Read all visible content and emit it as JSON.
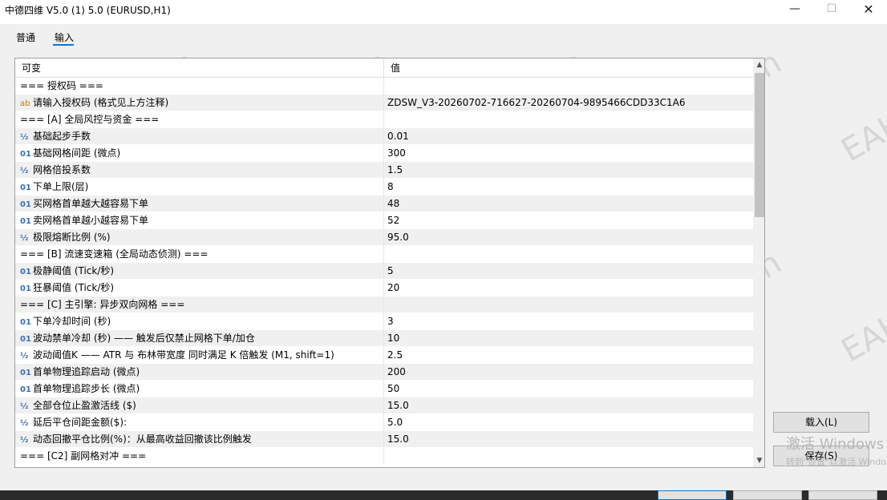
{
  "window": {
    "title": "中德四维 V5.0 (1) 5.0 (EURUSD,H1)",
    "minimize_glyph": "—",
    "maximize_glyph": "☐",
    "close_glyph": "✕"
  },
  "tabs": [
    {
      "label": "普通",
      "active": false
    },
    {
      "label": "输入",
      "active": true
    }
  ],
  "table": {
    "headers": {
      "variable": "可变",
      "value": "值"
    },
    "rows": [
      {
        "icon": "",
        "label": "=== 授权码 ===",
        "value": ""
      },
      {
        "icon": "ab",
        "label": "请输入授权码 (格式见上方注释)",
        "value": "ZDSW_V3-20260702-716627-20260704-9895466CDD33C1A6"
      },
      {
        "icon": "",
        "label": "=== [A] 全局风控与资金 ===",
        "value": ""
      },
      {
        "icon": "½",
        "label": "基础起步手数",
        "value": "0.01"
      },
      {
        "icon": "01",
        "label": "基础网格间距 (微点)",
        "value": "300"
      },
      {
        "icon": "½",
        "label": "网格倍投系数",
        "value": "1.5"
      },
      {
        "icon": "01",
        "label": "下单上限(层)",
        "value": "8"
      },
      {
        "icon": "01",
        "label": "买网格首单越大越容易下单",
        "value": "48"
      },
      {
        "icon": "01",
        "label": "卖网格首单越小越容易下单",
        "value": "52"
      },
      {
        "icon": "½",
        "label": "极限熔断比例 (%)",
        "value": "95.0"
      },
      {
        "icon": "",
        "label": "=== [B] 流速变速箱 (全局动态侦测) ===",
        "value": ""
      },
      {
        "icon": "01",
        "label": "极静阈值 (Tick/秒)",
        "value": "5"
      },
      {
        "icon": "01",
        "label": "狂暴阈值 (Tick/秒)",
        "value": "20"
      },
      {
        "icon": "",
        "label": "=== [C] 主引擎: 异步双向网格 ===",
        "value": ""
      },
      {
        "icon": "01",
        "label": "下单冷却时间 (秒)",
        "value": "3"
      },
      {
        "icon": "01",
        "label": "波动禁单冷却 (秒) —— 触发后仅禁止网格下单/加仓",
        "value": "10"
      },
      {
        "icon": "½",
        "label": "波动阈值K —— ATR 与 布林带宽度 同时满足 K 倍触发 (M1, shift=1)",
        "value": "2.5"
      },
      {
        "icon": "01",
        "label": "首单物理追踪启动 (微点)",
        "value": "200"
      },
      {
        "icon": "01",
        "label": "首单物理追踪步长 (微点)",
        "value": "50"
      },
      {
        "icon": "½",
        "label": "全部仓位止盈激活线 ($)",
        "value": "15.0"
      },
      {
        "icon": "½",
        "label": "延后平仓间距金额($):",
        "value": "5.0"
      },
      {
        "icon": "½",
        "label": "动态回撤平仓比例(%)：从最高收益回撤该比例触发",
        "value": "15.0"
      },
      {
        "icon": "",
        "label": "=== [C2] 副网格对冲 ===",
        "value": ""
      }
    ]
  },
  "scrollbar": {
    "up_glyph": "▲",
    "down_glyph": "▼"
  },
  "buttons": {
    "load": "载入(L)",
    "save": "保存(S)"
  },
  "watermark": {
    "text": "EAHub.cn"
  },
  "activation_notice": {
    "title": "激活 Windows",
    "subtitle": "转到\"设置\"以激活 Windows。"
  }
}
